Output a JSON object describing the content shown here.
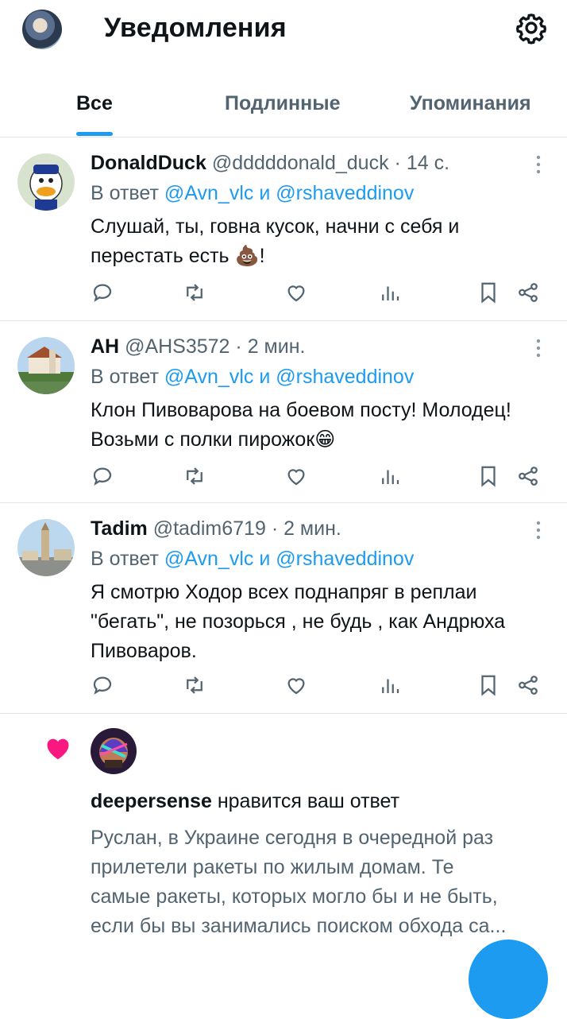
{
  "header": {
    "title": "Уведомления"
  },
  "tabs": [
    {
      "label": "Все",
      "active": true
    },
    {
      "label": "Подлинные",
      "active": false
    },
    {
      "label": "Упоминания",
      "active": false
    }
  ],
  "tweets": [
    {
      "name": "DonaldDuck",
      "handle": "@dddddonald_duck",
      "time": "· 14 с.",
      "reply_prefix": "В ответ",
      "mention1": "@Avn_vlc",
      "conj": "и",
      "mention2": "@rshaveddinov",
      "text_l1": "Слушай, ты, говна кусок, начни с себя  и",
      "text_l2": "перестать есть 💩!",
      "text_l3": ""
    },
    {
      "name": "AH",
      "handle": "@AHS3572",
      "time": "· 2 мин.",
      "reply_prefix": "В ответ",
      "mention1": "@Avn_vlc",
      "conj": "и",
      "mention2": "@rshaveddinov",
      "text_l1": "Клон Пивоварова на боевом посту! Молодец!",
      "text_l2": "Возьми с полки пирожок😁",
      "text_l3": ""
    },
    {
      "name": "Tadim",
      "handle": "@tadim6719",
      "time": "· 2 мин.",
      "reply_prefix": "В ответ",
      "mention1": "@Avn_vlc",
      "conj": "и",
      "mention2": "@rshaveddinov",
      "text_l1": "Я смотрю Ходор всех поднапряг в реплаи",
      "text_l2": "\"бегать\", не позорься , не будь , как Андрюха",
      "text_l3": "Пивоваров."
    }
  ],
  "like_notification": {
    "user": "deepersense",
    "action": "нравится ваш ответ",
    "text_l1": "Руслан, в Украине сегодня в очередной раз",
    "text_l2": "прилетели ракеты по жилым домам. Те",
    "text_l3": "самые ракеты, которых могло бы и не быть,",
    "text_l4": "если бы вы занимались поиском обхода са..."
  },
  "icons": {
    "settings": "gear-icon",
    "more": "more-vertical-icon",
    "actions": [
      "reply-icon",
      "retweet-icon",
      "like-icon",
      "views-icon",
      "bookmark-icon",
      "share-icon"
    ],
    "notification": "heart-icon"
  },
  "colors": {
    "accent": "#1d9bf0",
    "secondary_text": "#536471",
    "like": "#f91880"
  }
}
